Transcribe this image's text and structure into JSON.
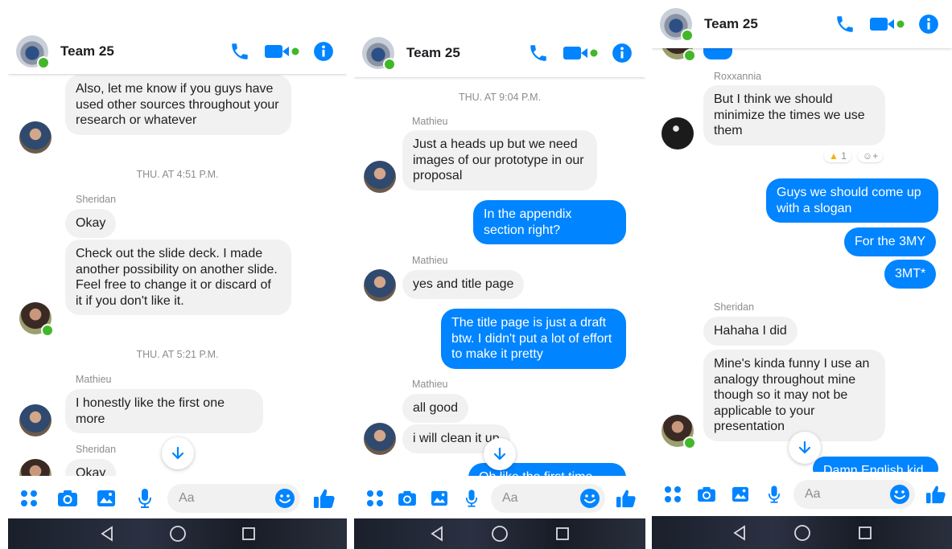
{
  "thread": {
    "title": "Team 25",
    "composer_placeholder": "Aa"
  },
  "icons": {
    "call": "phone-icon",
    "video": "video-camera-icon",
    "info": "info-icon",
    "apps": "four-dots-icon",
    "camera": "camera-icon",
    "gallery": "image-icon",
    "mic": "microphone-icon",
    "emoji": "smiley-icon",
    "like": "thumbs-up-icon",
    "jump": "arrow-down-icon",
    "nav_back": "triangle-back-icon",
    "nav_home": "circle-home-icon",
    "nav_recent": "square-recent-icon"
  },
  "colors": {
    "accent": "#0084ff",
    "online": "#42b72a",
    "incoming_bubble": "#f1f1f1"
  },
  "panel1": {
    "messages": [
      {
        "text": "Also, let me know if you guys have used other sources throughout your research or whatever"
      },
      {
        "timestamp": "THU. AT 4:51 P.M."
      },
      {
        "sender": "Sheridan"
      },
      {
        "text": "Okay"
      },
      {
        "text": "Check out the slide deck. I made another possibility on another slide. Feel free to change it or discard of it if you don't like it."
      },
      {
        "timestamp": "THU. AT 5:21 P.M."
      },
      {
        "sender": "Mathieu"
      },
      {
        "text": "I honestly like the first one more"
      },
      {
        "sender": "Sheridan"
      },
      {
        "text": "Okay"
      }
    ]
  },
  "panel2": {
    "messages": [
      {
        "timestamp": "THU. AT 9:04 P.M."
      },
      {
        "sender": "Mathieu"
      },
      {
        "text": "Just a heads up but we need images of our prototype in our proposal"
      },
      {
        "text": "In the appendix section right?"
      },
      {
        "sender": "Mathieu"
      },
      {
        "text": "yes and title page"
      },
      {
        "text": "The title page is just a draft btw. I didn't put a lot of effort to make it pretty"
      },
      {
        "sender": "Mathieu"
      },
      {
        "text": "all good"
      },
      {
        "text": "i will clean it up"
      },
      {
        "text": "Oh like the first time you"
      }
    ]
  },
  "panel3": {
    "messages": [
      {
        "sender": "Roxxannia"
      },
      {
        "text": "But I think we should minimize the times we use them"
      },
      {
        "reaction": "1"
      },
      {
        "reaction_add": "+"
      },
      {
        "text": "Guys we should come up with a slogan"
      },
      {
        "text": "For the 3MY"
      },
      {
        "text": "3MT*"
      },
      {
        "sender": "Sheridan"
      },
      {
        "text": "Hahaha I did"
      },
      {
        "text": "Mine's kinda funny I use an analogy throughout mine though so it may not be applicable to your presentation"
      },
      {
        "text": "Damn English kid"
      }
    ]
  }
}
